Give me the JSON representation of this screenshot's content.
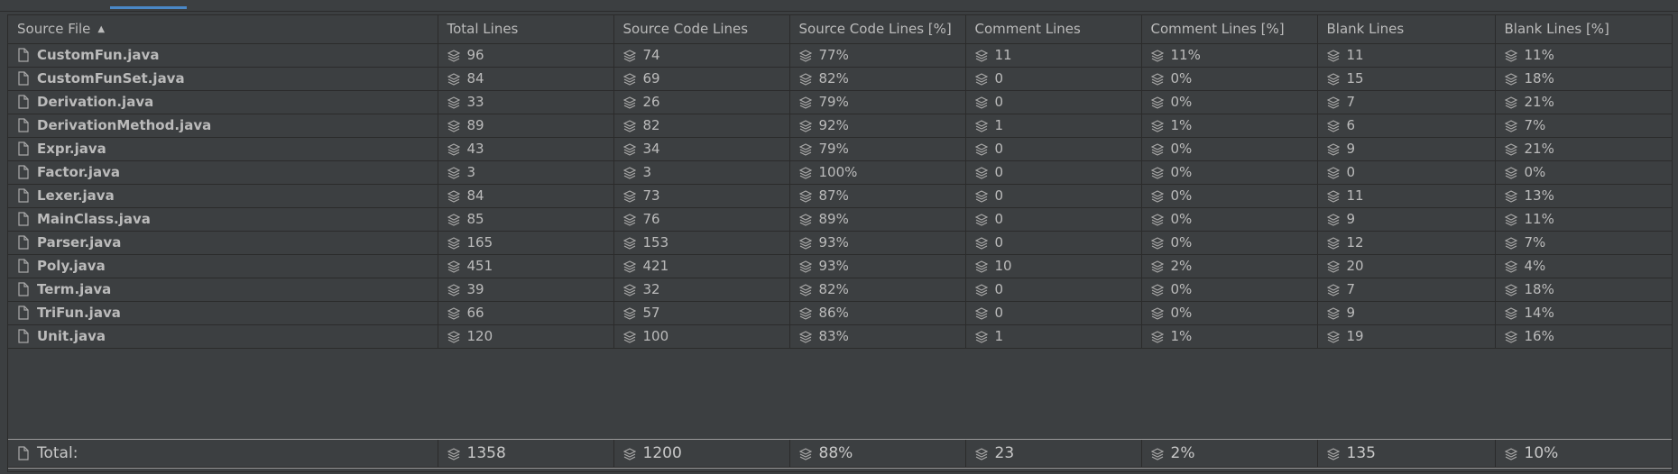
{
  "columns": [
    "Source File",
    "Total Lines",
    "Source Code Lines",
    "Source Code Lines [%]",
    "Comment Lines",
    "Comment Lines [%]",
    "Blank Lines",
    "Blank Lines [%]"
  ],
  "sort": {
    "column": "Source File",
    "direction": "ascending",
    "icon": "sort-ascending-icon"
  },
  "row_icon": "file-icon",
  "metric_icon": "stack-icon",
  "rows": [
    {
      "file": "CustomFun.java",
      "total": "96",
      "source": "74",
      "source_pct": "77%",
      "comment": "11",
      "comment_pct": "11%",
      "blank": "11",
      "blank_pct": "11%"
    },
    {
      "file": "CustomFunSet.java",
      "total": "84",
      "source": "69",
      "source_pct": "82%",
      "comment": "0",
      "comment_pct": "0%",
      "blank": "15",
      "blank_pct": "18%"
    },
    {
      "file": "Derivation.java",
      "total": "33",
      "source": "26",
      "source_pct": "79%",
      "comment": "0",
      "comment_pct": "0%",
      "blank": "7",
      "blank_pct": "21%"
    },
    {
      "file": "DerivationMethod.java",
      "total": "89",
      "source": "82",
      "source_pct": "92%",
      "comment": "1",
      "comment_pct": "1%",
      "blank": "6",
      "blank_pct": "7%"
    },
    {
      "file": "Expr.java",
      "total": "43",
      "source": "34",
      "source_pct": "79%",
      "comment": "0",
      "comment_pct": "0%",
      "blank": "9",
      "blank_pct": "21%"
    },
    {
      "file": "Factor.java",
      "total": "3",
      "source": "3",
      "source_pct": "100%",
      "comment": "0",
      "comment_pct": "0%",
      "blank": "0",
      "blank_pct": "0%"
    },
    {
      "file": "Lexer.java",
      "total": "84",
      "source": "73",
      "source_pct": "87%",
      "comment": "0",
      "comment_pct": "0%",
      "blank": "11",
      "blank_pct": "13%"
    },
    {
      "file": "MainClass.java",
      "total": "85",
      "source": "76",
      "source_pct": "89%",
      "comment": "0",
      "comment_pct": "0%",
      "blank": "9",
      "blank_pct": "11%"
    },
    {
      "file": "Parser.java",
      "total": "165",
      "source": "153",
      "source_pct": "93%",
      "comment": "0",
      "comment_pct": "0%",
      "blank": "12",
      "blank_pct": "7%"
    },
    {
      "file": "Poly.java",
      "total": "451",
      "source": "421",
      "source_pct": "93%",
      "comment": "10",
      "comment_pct": "2%",
      "blank": "20",
      "blank_pct": "4%"
    },
    {
      "file": "Term.java",
      "total": "39",
      "source": "32",
      "source_pct": "82%",
      "comment": "0",
      "comment_pct": "0%",
      "blank": "7",
      "blank_pct": "18%"
    },
    {
      "file": "TriFun.java",
      "total": "66",
      "source": "57",
      "source_pct": "86%",
      "comment": "0",
      "comment_pct": "0%",
      "blank": "9",
      "blank_pct": "14%"
    },
    {
      "file": "Unit.java",
      "total": "120",
      "source": "100",
      "source_pct": "83%",
      "comment": "1",
      "comment_pct": "1%",
      "blank": "19",
      "blank_pct": "16%"
    }
  ],
  "total": {
    "file": "Total:",
    "total": "1358",
    "source": "1200",
    "source_pct": "88%",
    "comment": "23",
    "comment_pct": "2%",
    "blank": "135",
    "blank_pct": "10%"
  },
  "colors": {
    "background": "#3c3f41",
    "grid": "#2b2b2b",
    "text": "#bbbbbb",
    "tab_accent": "#4a88c7"
  }
}
